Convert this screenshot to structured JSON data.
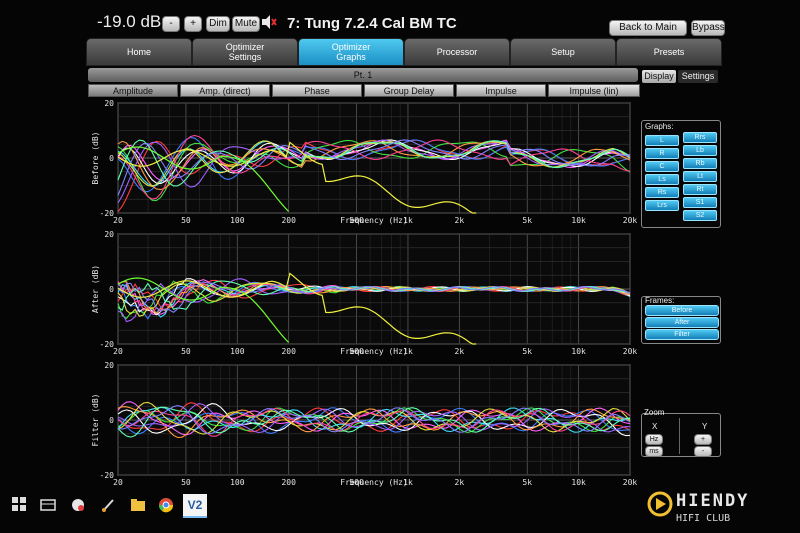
{
  "header": {
    "volume": "-19.0 dB",
    "minus_label": "-",
    "plus_label": "+",
    "dim_label": "Dim",
    "mute_label": "Mute",
    "preset_title": "7: Tung 7.2.4 Cal BM TC",
    "back_label": "Back to Main Screen",
    "bypass_label": "Bypass",
    "mute_icon": "speaker-muted-icon",
    "mute_color": "#e03030"
  },
  "tabs": [
    {
      "label": "Home"
    },
    {
      "label": "Optimizer\nSettings"
    },
    {
      "label": "Optimizer\nGraphs",
      "active": true
    },
    {
      "label": "Processor"
    },
    {
      "label": "Setup"
    },
    {
      "label": "Presets"
    }
  ],
  "point_bar": {
    "label": "Pt. 1"
  },
  "display_label": "Display",
  "settings_label": "Settings",
  "subtabs": [
    {
      "label": "Amplitude",
      "active": true
    },
    {
      "label": "Amp. (direct)"
    },
    {
      "label": "Phase"
    },
    {
      "label": "Group Delay"
    },
    {
      "label": "Impulse"
    },
    {
      "label": "Impulse (lin)"
    }
  ],
  "graphs": [
    {
      "ylabel": "Before (dB)",
      "xlabel": "Frequency (Hz)"
    },
    {
      "ylabel": "After (dB)",
      "xlabel": "Frequency (Hz)"
    },
    {
      "ylabel": "Filter (dB)",
      "xlabel": "Frequency (Hz)"
    }
  ],
  "x_ticks": [
    "20",
    "50",
    "100",
    "200",
    "500",
    "1k",
    "2k",
    "5k",
    "10k",
    "20k"
  ],
  "y_ticks": [
    "20",
    "0",
    "-20"
  ],
  "graphs_panel": {
    "title": "Graphs:",
    "channels_left": [
      "L",
      "R",
      "C",
      "Ls",
      "Rs",
      "Lrs"
    ],
    "channels_right": [
      "Rrs",
      "Lb",
      "Rb",
      "Lt",
      "Rt",
      "S1",
      "S2"
    ]
  },
  "frames_panel": {
    "title": "Frames:",
    "buttons": [
      "Before",
      "After",
      "Filter"
    ]
  },
  "zoom_panel": {
    "title": "Zoom",
    "x_label": "X",
    "y_label": "Y",
    "hz_label": "Hz",
    "ms_label": "ms",
    "plus_label": "+",
    "minus_label": "-"
  },
  "accent_color": "#29aee3",
  "watermark": {
    "brand": "HIENDY",
    "sub": "HIFI CLUB"
  },
  "taskbar": {
    "icons": [
      "start-icon",
      "task-view-icon",
      "app-icon",
      "pen-icon",
      "folder-icon",
      "chrome-icon",
      "app-v-icon"
    ],
    "active_app_label": "V2"
  }
}
